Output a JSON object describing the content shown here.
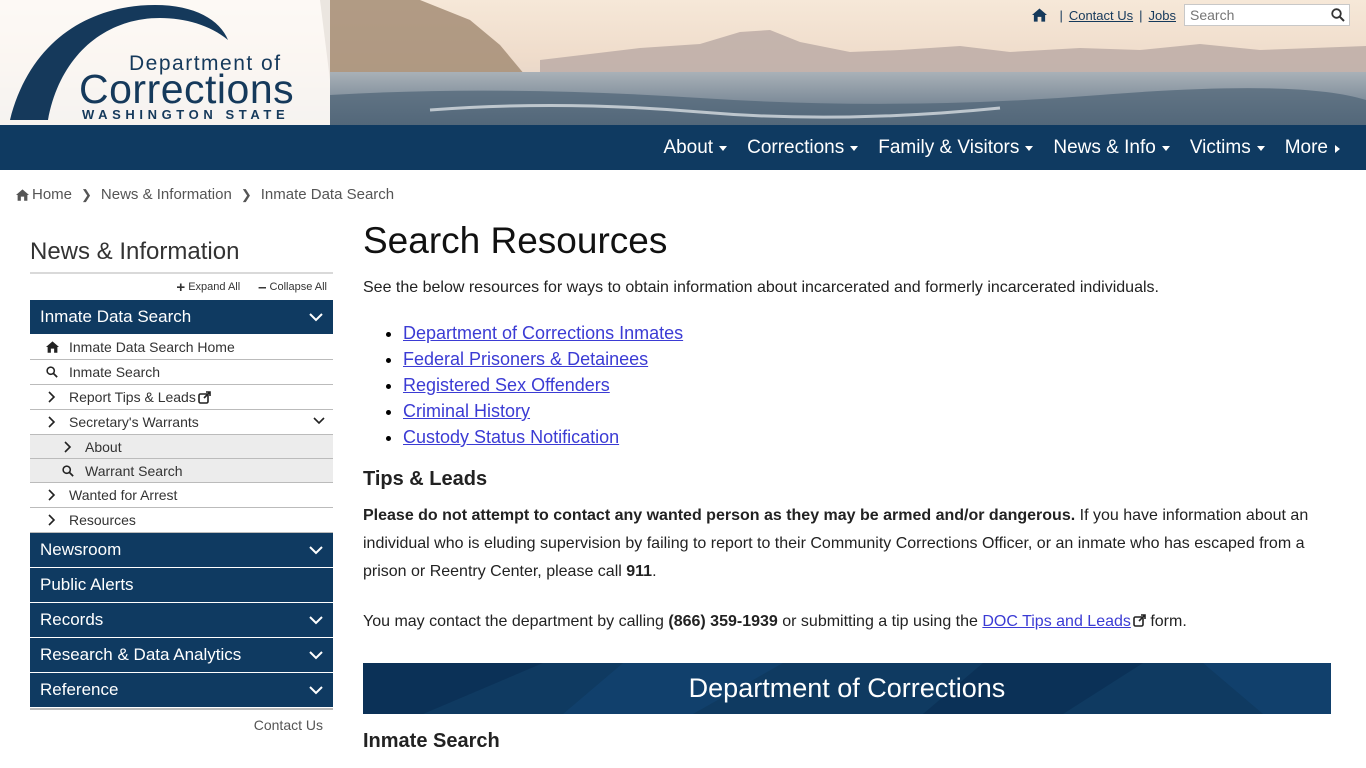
{
  "logo": {
    "line1": "Department of",
    "line2": "Corrections",
    "line3": "WASHINGTON STATE"
  },
  "utility": {
    "contact_label": "Contact Us",
    "jobs_label": "Jobs",
    "search_placeholder": "Search"
  },
  "nav": {
    "items": [
      {
        "label": "About"
      },
      {
        "label": "Corrections"
      },
      {
        "label": "Family & Visitors"
      },
      {
        "label": "News & Info"
      },
      {
        "label": "Victims"
      },
      {
        "label": "More"
      }
    ]
  },
  "breadcrumb": [
    "Home",
    "News & Information",
    "Inmate Data Search"
  ],
  "sidebar": {
    "title": "News & Information",
    "expand_label": "Expand All",
    "collapse_label": "Collapse All",
    "sections": [
      {
        "label": "Inmate Data Search"
      },
      {
        "label": "Newsroom"
      },
      {
        "label": "Public Alerts"
      },
      {
        "label": "Records"
      },
      {
        "label": "Research & Data Analytics"
      },
      {
        "label": "Reference"
      }
    ],
    "sub_items": [
      {
        "label": "Inmate Data Search Home"
      },
      {
        "label": "Inmate Search"
      },
      {
        "label": "Report Tips & Leads"
      },
      {
        "label": "Secretary's Warrants"
      },
      {
        "label": "About"
      },
      {
        "label": "Warrant Search"
      },
      {
        "label": "Wanted for Arrest"
      },
      {
        "label": "Resources"
      }
    ],
    "contact_label": "Contact Us"
  },
  "main": {
    "title": "Search Resources",
    "intro": "See the below resources for ways to obtain information about incarcerated and formerly incarcerated individuals.",
    "links": [
      "Department of Corrections Inmates",
      "Federal Prisoners & Detainees",
      "Registered Sex Offenders",
      "Criminal History",
      "Custody Status Notification"
    ],
    "tips_heading": "Tips & Leads",
    "warning_bold": "Please do not attempt to contact any wanted person as they may be armed and/or dangerous.",
    "warning_text": " If you have information about an individual who is eluding supervision by failing to report to their Community Corrections Officer, or an inmate who has escaped from a prison or Reentry Center, please call ",
    "call_number": "911",
    "period": ".",
    "contact_pre": "You may contact the department by calling ",
    "phone": "(866) 359-1939",
    "contact_mid": " or submitting a tip using the ",
    "tips_link": "DOC Tips and Leads",
    "contact_post": " form.",
    "banner_title": "Department of Corrections",
    "inmate_heading": "Inmate Search"
  },
  "colors": {
    "navy": "#0f3a61",
    "link": "#3b3bd4"
  }
}
